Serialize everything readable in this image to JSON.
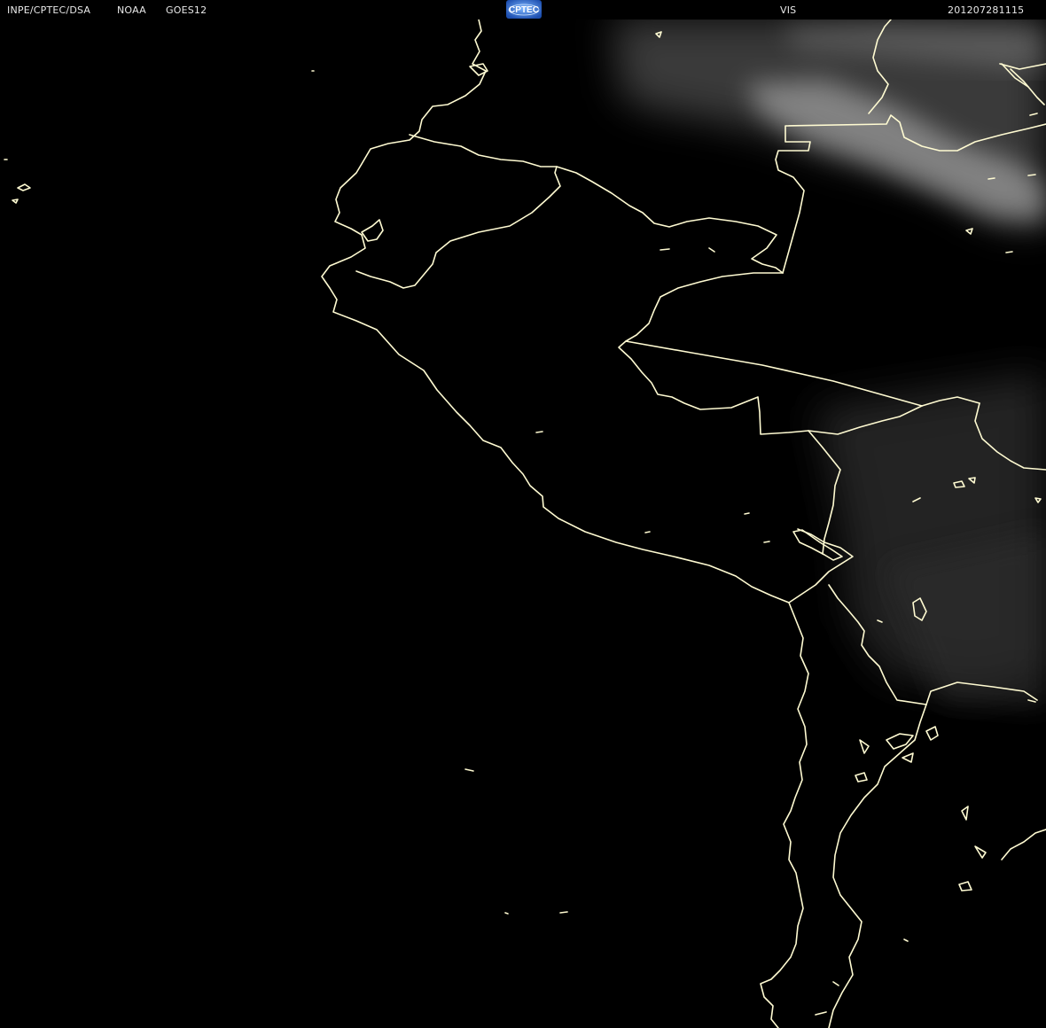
{
  "header": {
    "source": "INPE/CPTEC/DSA",
    "agency": "NOAA",
    "satellite": "GOES12",
    "channel": "VIS",
    "timestamp": "201207281115"
  },
  "logo": {
    "text": "CPTEC",
    "icon": "cptec-globe-logo"
  },
  "colors": {
    "background": "#000000",
    "coastline": "#fffbd2",
    "header_text": "#e8e8e8",
    "cloud": "#bfbfbf"
  }
}
